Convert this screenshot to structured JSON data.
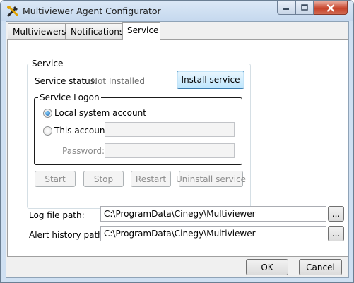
{
  "window": {
    "title": "Multiviewer Agent Configurator",
    "app_icon": "tools-icon"
  },
  "tabs": [
    {
      "label": "Multiviewers",
      "active": false
    },
    {
      "label": "Notifications",
      "active": false
    },
    {
      "label": "Service",
      "active": true
    }
  ],
  "service": {
    "group_label": "Service",
    "status_label": "Service status:",
    "status_value": "Not Installed",
    "install_button": "Install service",
    "logon": {
      "group_label": "Service Logon",
      "local_system_label": "Local system account",
      "this_account_label": "This account",
      "selected": "local_system",
      "account_value": "",
      "password_label": "Password:",
      "password_value": ""
    },
    "buttons": {
      "start": "Start",
      "stop": "Stop",
      "restart": "Restart",
      "uninstall": "Uninstall service"
    }
  },
  "paths": {
    "log_label": "Log file path:",
    "log_value": "C:\\ProgramData\\Cinegy\\Multiviewer",
    "alert_label": "Alert history path:",
    "alert_value": "C:\\ProgramData\\Cinegy\\Multiviewer",
    "browse_label": "..."
  },
  "dialog": {
    "ok": "OK",
    "cancel": "Cancel"
  }
}
